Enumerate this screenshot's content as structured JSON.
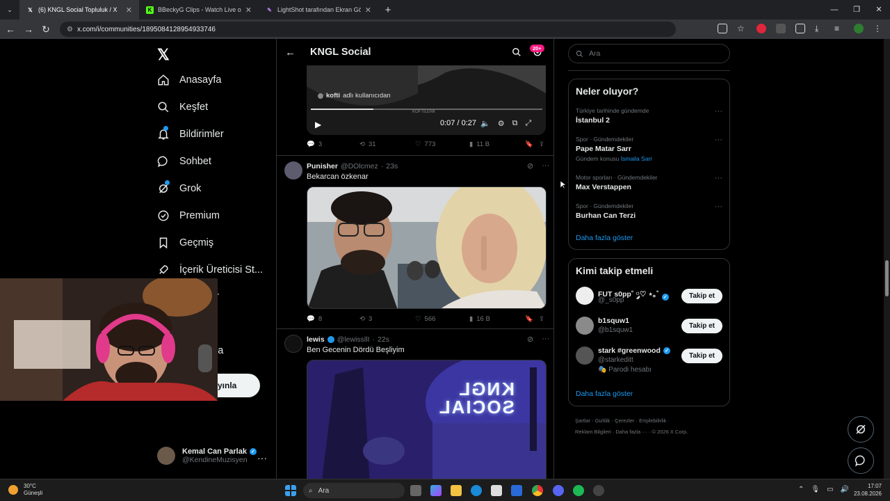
{
  "browser": {
    "tabs": [
      {
        "title": "(6) KNGL Social Topluluk / X",
        "active": true,
        "favicon": "x-icon"
      },
      {
        "title": "BBeckyG Clips - Watch Live on K",
        "active": false,
        "favicon": "kick-icon"
      },
      {
        "title": "LightShot tarafından Ekran Görü",
        "active": false,
        "favicon": "lightshot-icon"
      }
    ],
    "url": "x.com/i/communities/1895084128954933746"
  },
  "nav": {
    "items": [
      {
        "label": "Anasayfa",
        "icon": "home-icon"
      },
      {
        "label": "Keşfet",
        "icon": "search-icon"
      },
      {
        "label": "Bildirimler",
        "icon": "bell-icon"
      },
      {
        "label": "Sohbet",
        "icon": "chat-icon"
      },
      {
        "label": "Grok",
        "icon": "grok-icon"
      },
      {
        "label": "Premium",
        "icon": "premium-icon"
      },
      {
        "label": "Geçmiş",
        "icon": "bookmark-icon"
      },
      {
        "label": "İçerik Üreticisi St...",
        "icon": "rocket-icon"
      }
    ],
    "partial_labels": [
      "r",
      "la"
    ],
    "post_button_partial": "yınla",
    "profile": {
      "name": "Kemal Can Parlak",
      "handle": "@KendineMuzisyen"
    }
  },
  "main": {
    "header": {
      "title": "KNGL Social",
      "badge": "20+"
    },
    "video": {
      "caption_user": "kofti",
      "caption_text": "adlı kullanıcıdan",
      "watermark": "KOFTİLENK",
      "time": "0:07 / 0:27",
      "progress": 0.27
    },
    "video_actions": {
      "replies": "3",
      "reposts": "31",
      "likes": "773",
      "views": "11 B"
    },
    "tweets": [
      {
        "name": "Punisher",
        "handle": "@DOlcmez",
        "time": "23s",
        "text": "Bekarcan özkenar",
        "verified": false,
        "actions": {
          "replies": "8",
          "reposts": "3",
          "likes": "566",
          "views": "16 B"
        }
      },
      {
        "name": "lewis",
        "handle": "@lewissllI",
        "time": "22s",
        "text": "Ben Gecenin Dördü Beşliyim",
        "verified": true
      }
    ],
    "neon_text": "KNGL SOCIAL"
  },
  "right": {
    "search_placeholder": "Ara",
    "trends_title": "Neler oluyor?",
    "trends": [
      {
        "meta": "Türkiye tarihinde gündemde",
        "name": "İstanbul 2",
        "sub": "",
        "sub_link": ""
      },
      {
        "meta": "Spor · Gündemdekiler",
        "name": "Pape Matar Sarr",
        "sub": "Gündem konusu",
        "sub_link": "İsmaila Sarr"
      },
      {
        "meta": "Motor sporları · Gündemdekiler",
        "name": "Max Verstappen",
        "sub": "",
        "sub_link": ""
      },
      {
        "meta": "Spor · Gündemdekiler",
        "name": "Burhan Can Terzi",
        "sub": "",
        "sub_link": ""
      }
    ],
    "trends_more": "Daha fazla göster",
    "who_title": "Kimi takip etmeli",
    "who": [
      {
        "name": "FUT s0pp˚ ༘♡ ⋆｡˚",
        "handle": "@_s0pp",
        "verified": true,
        "follow": "Takip et",
        "parody": ""
      },
      {
        "name": "b1squw1",
        "handle": "@b1squw1",
        "verified": false,
        "follow": "Takip et",
        "parody": ""
      },
      {
        "name": "stark #greenwood",
        "handle": "@starkeditt",
        "verified": true,
        "follow": "Takip et",
        "parody": "🎭 Parodi hesabı"
      }
    ],
    "who_more": "Daha fazla göster",
    "footer": [
      "Şartlar",
      "Gizlilik",
      "Çerezler",
      "Erişilebilirlik",
      "Reklam Bilgileri",
      "Daha fazla ···",
      "© 2026 X Corp."
    ]
  },
  "taskbar": {
    "weather_temp": "30°C",
    "weather_desc": "Güneşli",
    "search_label": "Ara",
    "time": "17:07",
    "date": "23.08.2026"
  },
  "colors": {
    "accent": "#1d9bf0",
    "background": "#000000",
    "border": "#2f3336",
    "muted": "#71767b",
    "badge": "#f91880"
  }
}
